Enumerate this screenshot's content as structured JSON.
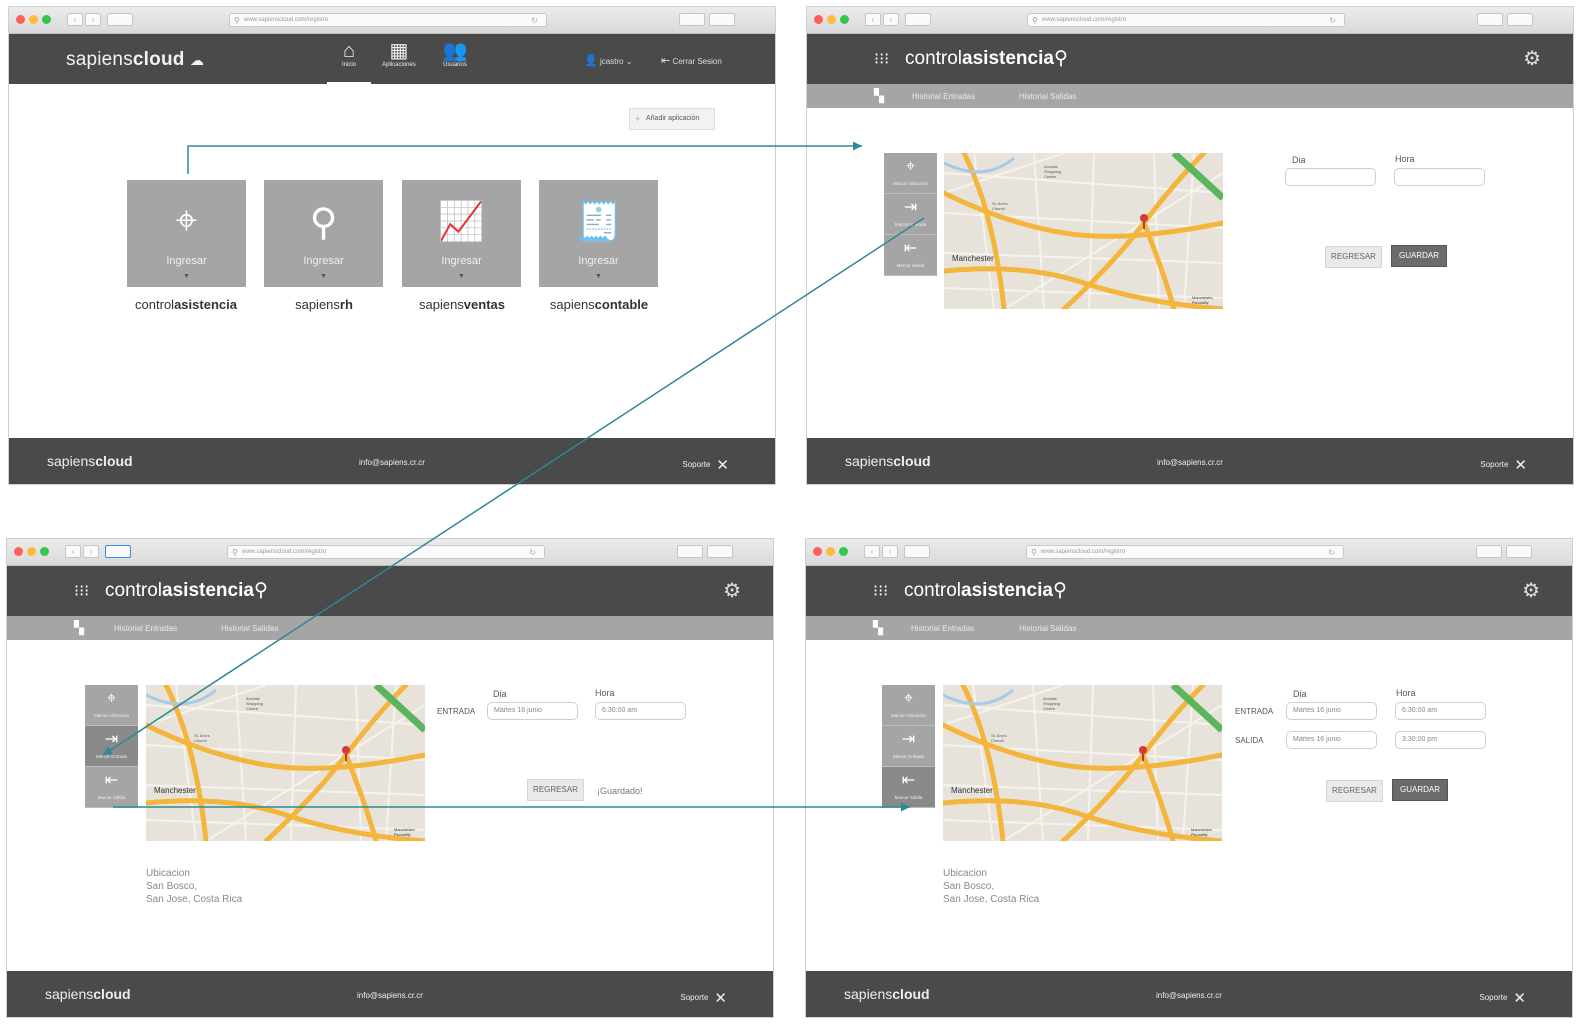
{
  "browser": {
    "url": "www.sapienscloud.com/registro"
  },
  "portal": {
    "logo_regular": "sapiens",
    "logo_bold": "cloud",
    "nav": [
      {
        "label": "Inicio",
        "icon": "home-icon"
      },
      {
        "label": "Aplicaciones",
        "icon": "apps-icon"
      },
      {
        "label": "Usuarios",
        "icon": "users-icon"
      }
    ],
    "user": "jcastro",
    "logout": "Cerrar Sesion",
    "add_app": "Añadir aplicación",
    "tile_button": "Ingresar",
    "apps": [
      {
        "name_regular": "control",
        "name_bold": "asistencia",
        "icon": "location-pin-icon"
      },
      {
        "name_regular": "sapiens",
        "name_bold": "rh",
        "icon": "people-search-icon"
      },
      {
        "name_regular": "sapiens",
        "name_bold": "ventas",
        "icon": "sales-chart-icon"
      },
      {
        "name_regular": "sapiens",
        "name_bold": "contable",
        "icon": "accounting-icon"
      }
    ]
  },
  "app": {
    "logo_regular": "control",
    "logo_bold": "asistencia",
    "tabs": [
      "Historial Entradas",
      "Historial Salidas"
    ],
    "side_buttons": [
      "Marcar Ubicación",
      "Marcar Entrada",
      "Marcar Salida"
    ],
    "col_dia": "Dia",
    "col_hora": "Hora",
    "entrada_label": "ENTRADA",
    "salida_label": "SALIDA",
    "entrada_dia": "Martes 16 junio",
    "entrada_hora": "6:30:00 am",
    "salida_dia": "Martes 16 junio",
    "salida_hora": "3:30:00 pm",
    "regresar": "REGRESAR",
    "guardar": "GUARDAR",
    "saved_msg": "¡Guardado!",
    "location_title": "Ubicacion",
    "location_line1": "San Bosco,",
    "location_line2": "San Jose, Costa Rica",
    "map_labels": [
      "Manchester",
      "Manchester Piccadilly",
      "St. Ann's Church",
      "Arndale Shopping Centre"
    ]
  },
  "footer": {
    "logo_regular": "sapiens",
    "logo_bold": "cloud",
    "email": "info@sapiens.cr.cr",
    "support": "Soporte"
  },
  "colors": {
    "bar": "#4a4a4a",
    "subbar": "#a5a5a5",
    "arrow": "#2a8b94"
  }
}
